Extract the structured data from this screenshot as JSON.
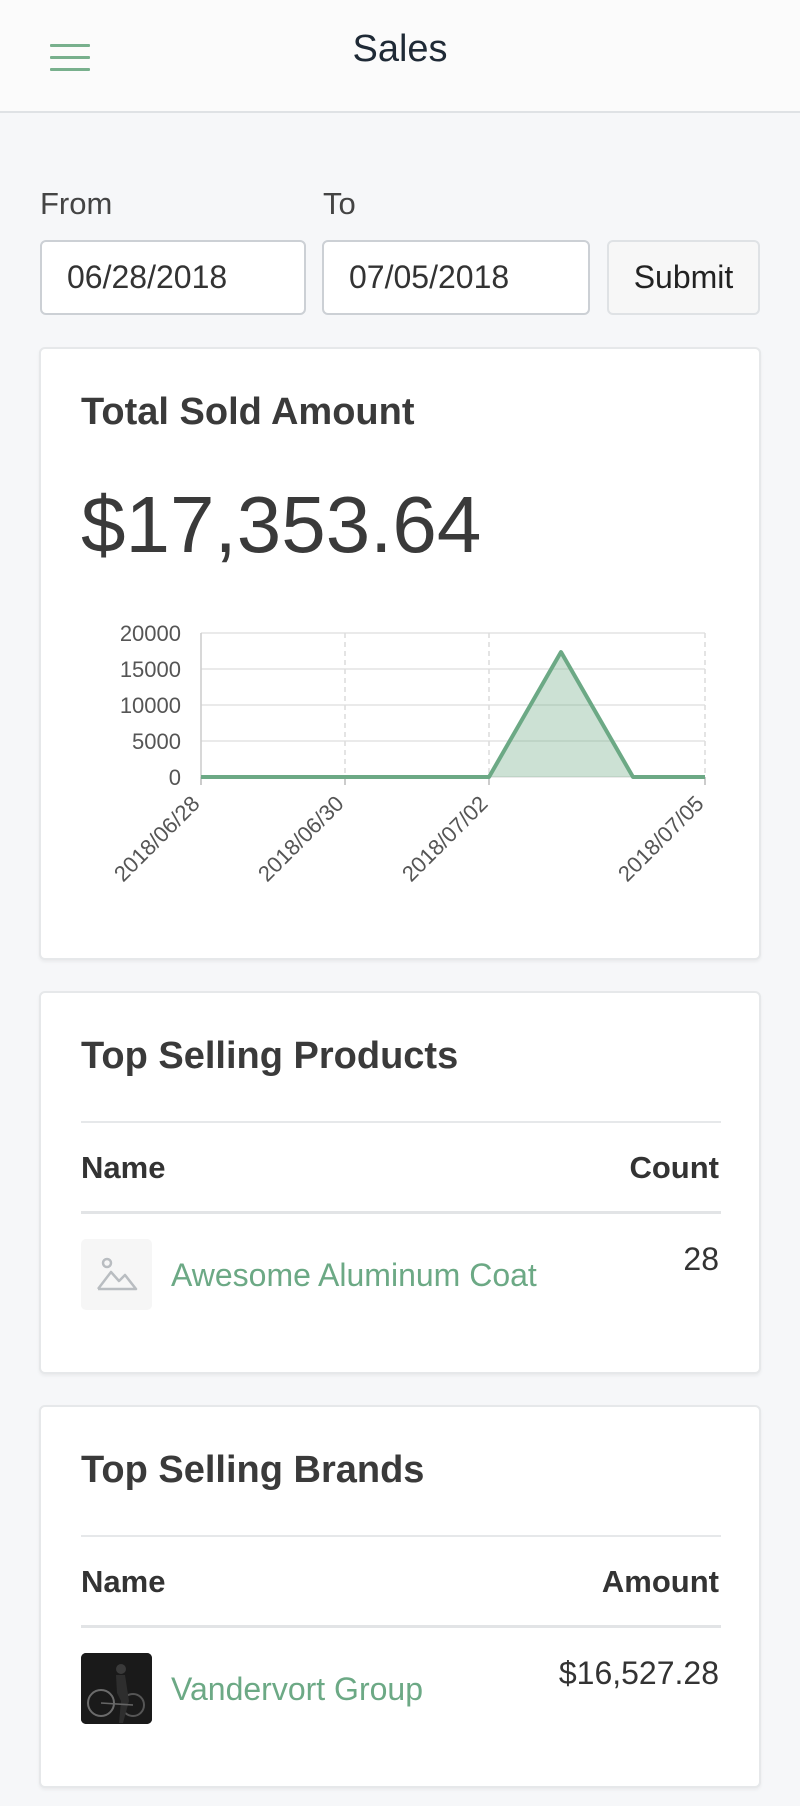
{
  "header": {
    "title": "Sales",
    "menu_icon": "hamburger-icon"
  },
  "filters": {
    "from_label": "From",
    "to_label": "To",
    "from_value": "06/28/2018",
    "to_value": "07/05/2018",
    "submit_label": "Submit"
  },
  "total_card": {
    "title": "Total Sold Amount",
    "amount": "$17,353.64"
  },
  "chart_data": {
    "type": "area",
    "x": [
      "2018/06/28",
      "2018/06/29",
      "2018/06/30",
      "2018/07/01",
      "2018/07/02",
      "2018/07/03",
      "2018/07/04",
      "2018/07/05"
    ],
    "values": [
      0,
      0,
      0,
      0,
      0,
      17353.64,
      0,
      0
    ],
    "x_tick_labels": [
      "2018/06/28",
      "2018/06/30",
      "2018/07/02",
      "2018/07/05"
    ],
    "y_ticks": [
      0,
      5000,
      10000,
      15000,
      20000
    ],
    "ylim": [
      0,
      20000
    ],
    "color": "#6ca985",
    "grid": true
  },
  "products_card": {
    "title": "Top Selling Products",
    "col_name": "Name",
    "col_count": "Count",
    "rows": [
      {
        "name": "Awesome Aluminum Coat",
        "count": "28",
        "thumb_icon": "image-placeholder-icon"
      }
    ]
  },
  "brands_card": {
    "title": "Top Selling Brands",
    "col_name": "Name",
    "col_amount": "Amount",
    "rows": [
      {
        "name": "Vandervort Group",
        "amount": "$16,527.28"
      }
    ]
  },
  "colors": {
    "accent": "#6ca985",
    "background": "#f6f7f9"
  }
}
